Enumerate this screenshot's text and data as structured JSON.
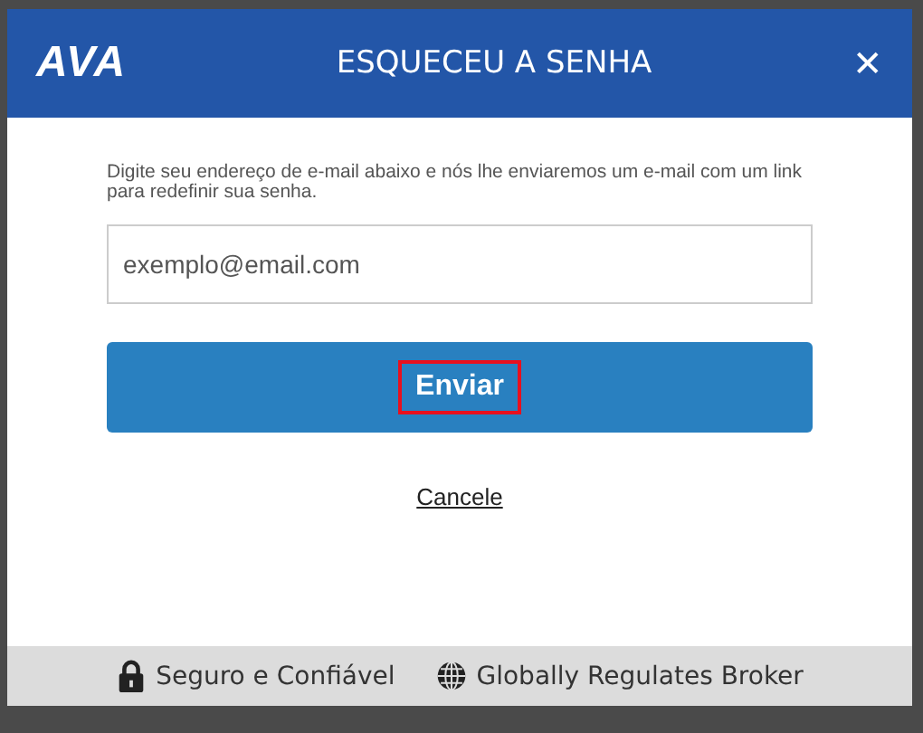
{
  "dialog": {
    "logo": "AVA",
    "title": "ESQUECEU A SENHA",
    "close": "✕"
  },
  "instructions": "Digite seu endereço de e-mail abaixo e nós lhe enviaremos um e-mail com um link para redefinir sua senha.",
  "email_field": {
    "placeholder": "exemplo@email.com"
  },
  "submit_button": {
    "label": "Enviar",
    "highlighted": true
  },
  "cancel_link": "Cancele",
  "footer": [
    {
      "kind": "lock",
      "label": "Seguro e Confiável"
    },
    {
      "kind": "globe",
      "label": "Globally Regulates Broker"
    }
  ]
}
